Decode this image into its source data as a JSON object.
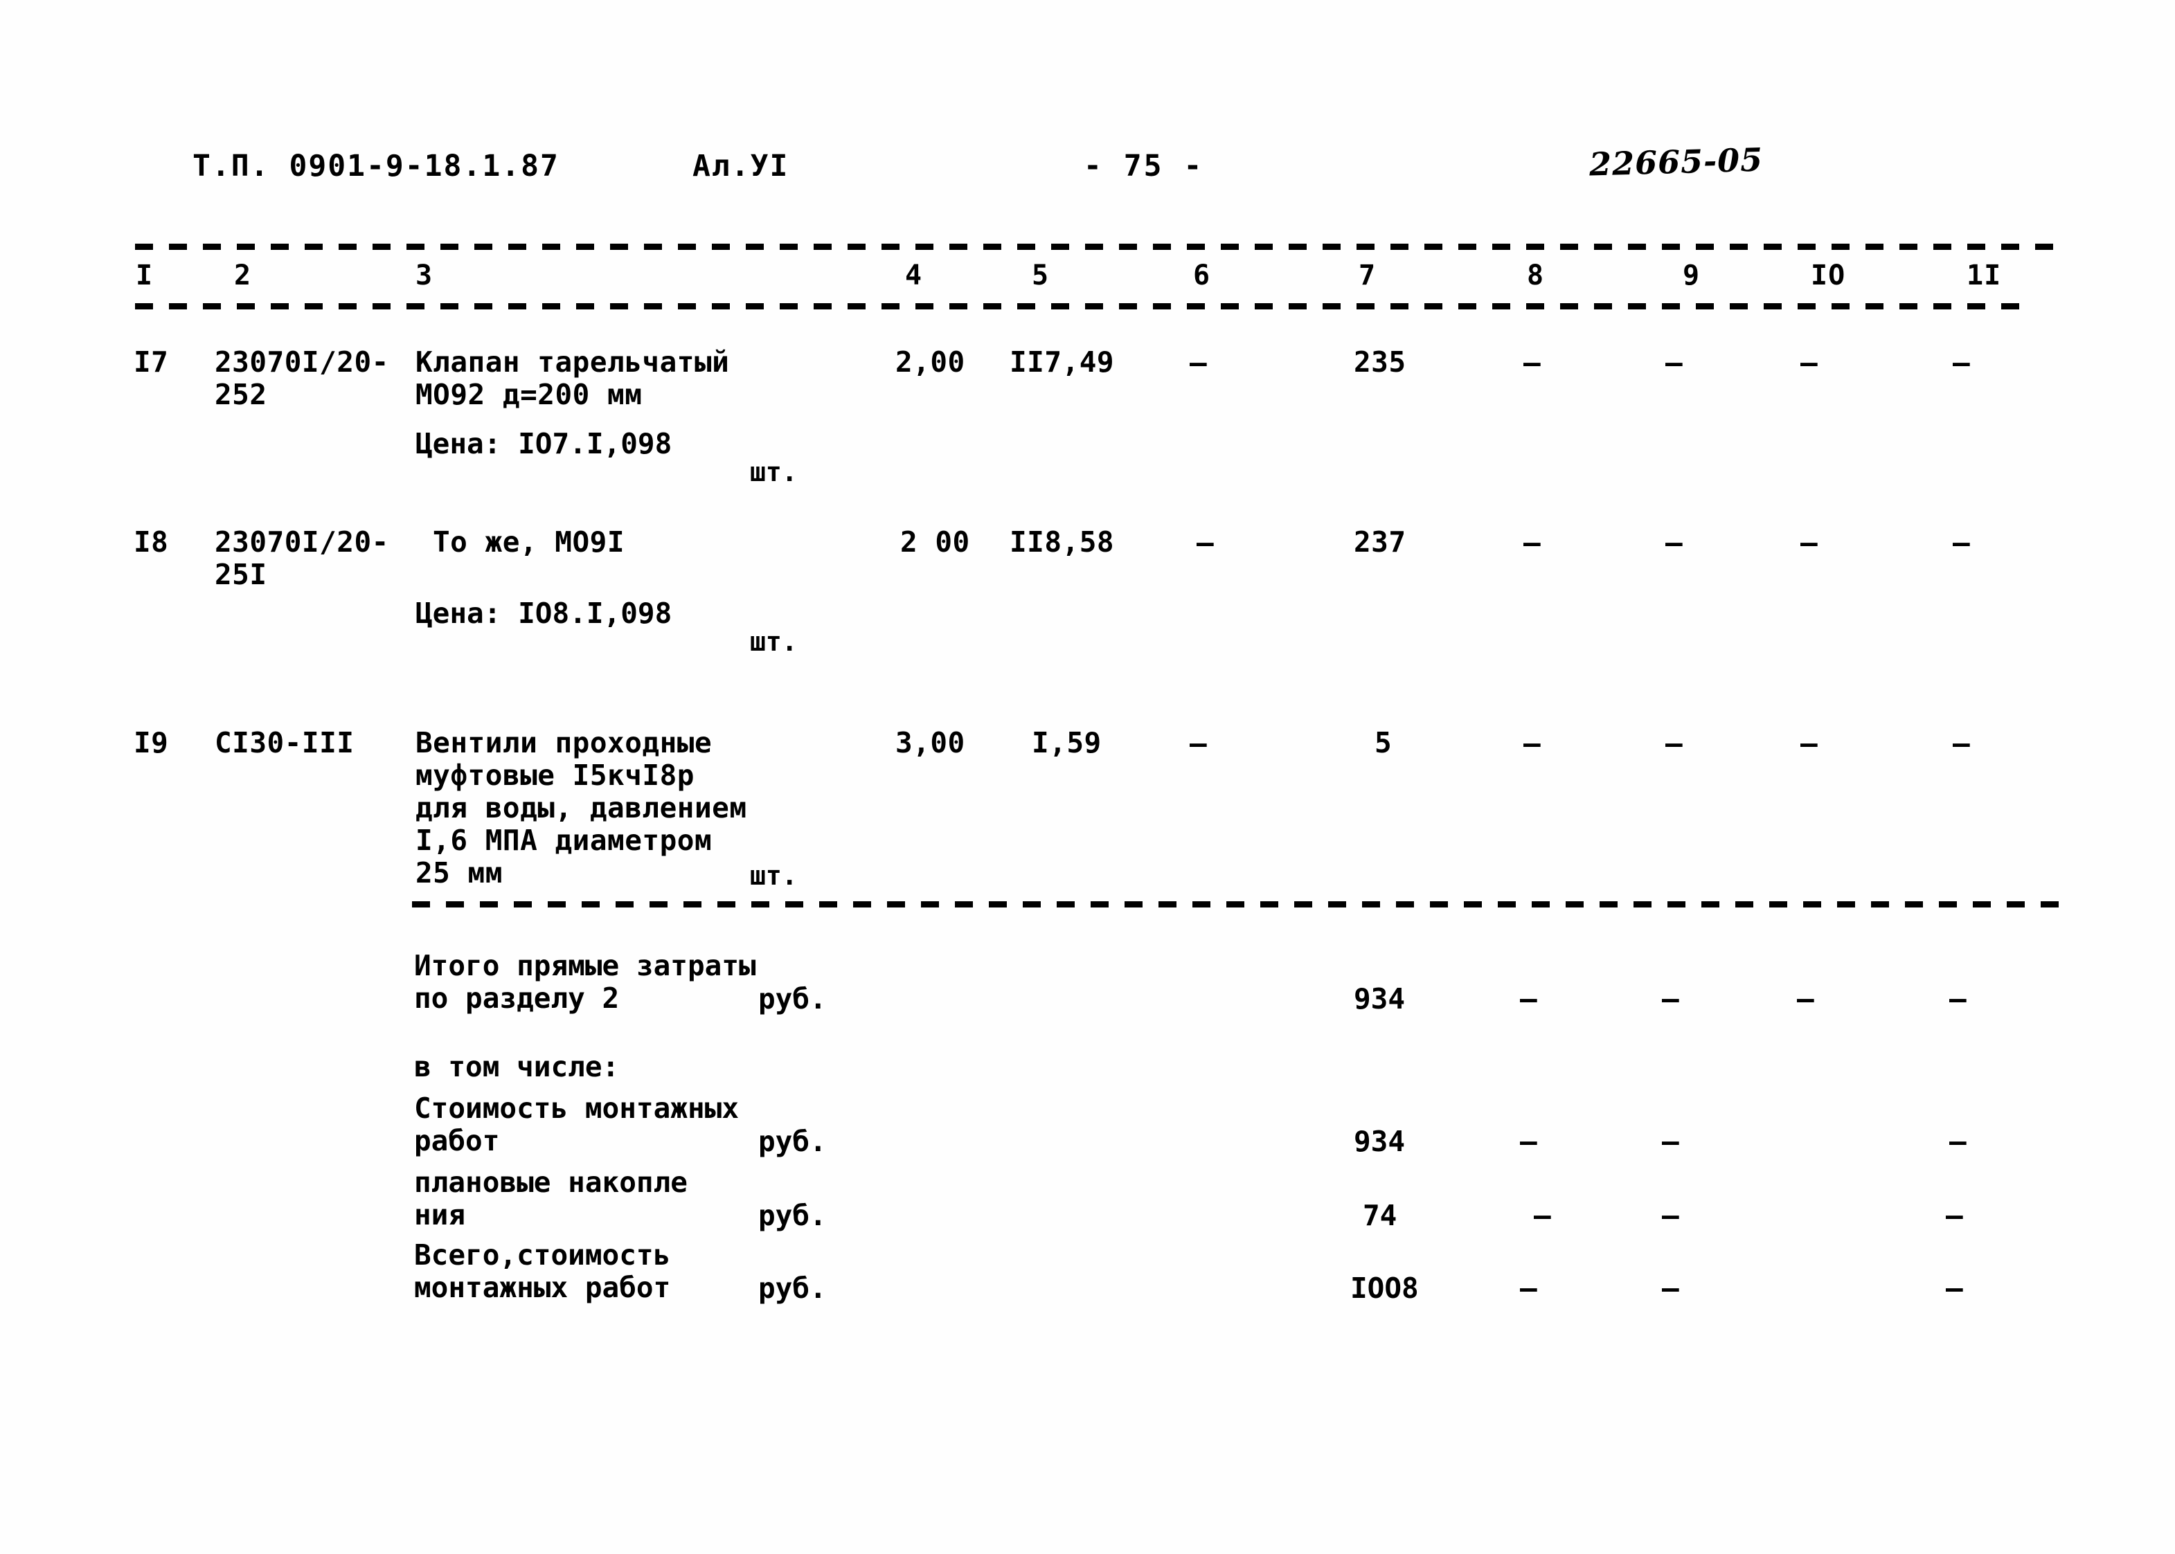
{
  "header": {
    "doc_code": "Т.П.  0901-9-18.1.87",
    "album": "Ал.УI",
    "page_number": "- 75 -",
    "stamp_number": "22665-05"
  },
  "table": {
    "column_headers": [
      "I",
      "2",
      "3",
      "4",
      "5",
      "6",
      "7",
      "8",
      "9",
      "IO",
      "1I"
    ],
    "rows": [
      {
        "no": "I7",
        "code": "23070I/20-\n252",
        "description": "Клапан тарельчатый\nМО92   д=200 мм",
        "price_note": "Цена: IO7.I,098",
        "unit": "шт.",
        "qty": "2,00",
        "rate": "II7,49",
        "col6": "–",
        "total": "235",
        "col8": "–",
        "col9": "–",
        "col10": "–",
        "col11": "–"
      },
      {
        "no": "I8",
        "code": "23070I/20-\n25I",
        "description": "То же, МО9I",
        "price_note": "Цена: IO8.I,098",
        "unit": "шт.",
        "qty": "2 00",
        "rate": "II8,58",
        "col6": "–",
        "total": "237",
        "col8": "–",
        "col9": "–",
        "col10": "–",
        "col11": "–"
      },
      {
        "no": "I9",
        "code": "СI30-III",
        "description": "Вентили проходные\nмуфтовые I5кчI8р\nдля воды, давлением\nI,6 МПА  диаметром\n25 мм",
        "price_note": "",
        "unit": "шт.",
        "qty": "3,00",
        "rate": "I,59",
        "col6": "–",
        "total": "5",
        "col8": "–",
        "col9": "–",
        "col10": "–",
        "col11": "–"
      }
    ],
    "summary": [
      {
        "label": "Итого прямые затраты\nпо разделу 2",
        "unit": "руб.",
        "value": "934",
        "col8": "–",
        "col9": "–",
        "col10": "–",
        "col11": "–"
      },
      {
        "label": "в том числе:",
        "unit": "",
        "value": "",
        "col8": "",
        "col9": "",
        "col10": "",
        "col11": ""
      },
      {
        "label": "Стоимость монтажных\nработ",
        "unit": "руб.",
        "value": "934",
        "col8": "–",
        "col9": "–",
        "col10": "",
        "col11": "–"
      },
      {
        "label": "  плановые накопле\n  ния",
        "unit": "руб.",
        "value": "74",
        "col8": "–",
        "col9": "–",
        "col10": "",
        "col11": "–"
      },
      {
        "label": "Всего,стоимость\nмонтажных работ",
        "unit": "руб.",
        "value": "IOO8",
        "col8": "–",
        "col9": "–",
        "col10": "",
        "col11": "–"
      }
    ]
  }
}
